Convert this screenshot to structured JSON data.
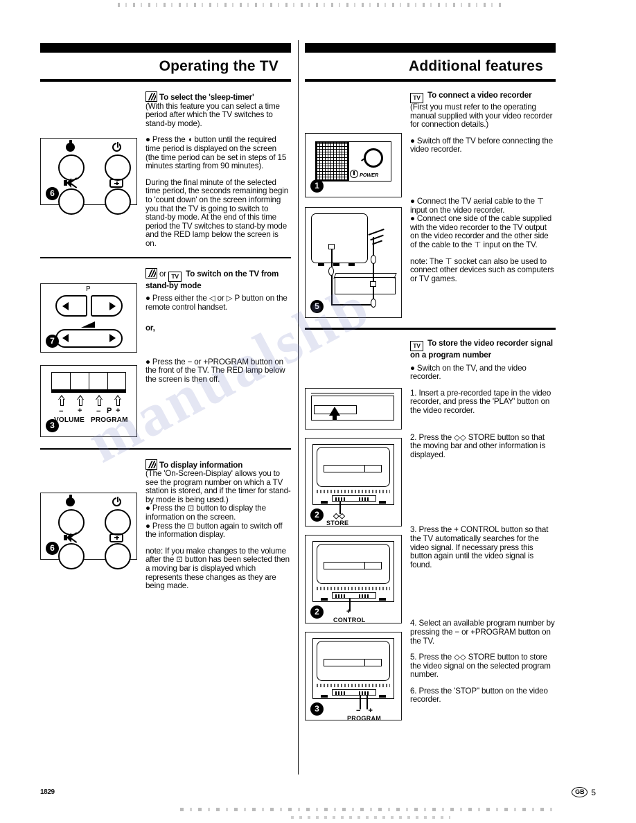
{
  "page": {
    "footer_code": "1829",
    "footer_region": "GB",
    "footer_page": "5",
    "watermark": "manualslib"
  },
  "left_column": {
    "header": "Operating the TV",
    "sections": [
      {
        "icon": "remote-icon",
        "heading": "To select the 'sleep-timer'",
        "paragraphs": [
          "(With this feature you can select a time period after which the TV switches to stand-by mode).",
          "● Press the ◖ button until the required time period is displayed on the screen (the time period can be set in steps of 15 minutes starting from 90 minutes).",
          "During the final minute of the selected time period, the seconds remaining begin to 'count down' on the screen informing you that the TV is going to switch to stand-by mode. At the end of this time period the TV switches to stand-by mode and the RED lamp below the screen is on."
        ],
        "figure": {
          "number": "6",
          "type": "remote-keypad"
        }
      },
      {
        "icon": "remote-icon",
        "icon2": "tv-icon",
        "connector": "or",
        "heading": "To switch on the TV from stand-by mode",
        "paragraphs": [
          "● Press either the ◁ or ▷ P button on the remote control handset.",
          "or,",
          "● Press the − or +PROGRAM button on the front of the TV. The RED lamp below the screen is then off."
        ],
        "figure": {
          "number": "7",
          "type": "rocker-keys",
          "label_p": "P"
        },
        "figure2": {
          "number": "3",
          "type": "front-panel",
          "symbols": [
            "−",
            "+",
            "−",
            "P",
            "+"
          ],
          "caption_left": "VOLUME",
          "caption_right": "PROGRAM"
        }
      },
      {
        "icon": "remote-icon",
        "heading": "To display information",
        "paragraphs": [
          "(The 'On-Screen-Display' allows you to see the program number on which a TV station is stored, and if the timer for stand-by mode is being used.)",
          "● Press the ⊡ button to display the information on the screen.",
          "● Press the ⊡ button again to switch off the information display.",
          "note: If you make changes to the volume after the ⊡ button has been selected then a moving bar is displayed which represents these changes as they are being made."
        ],
        "figure": {
          "number": "6",
          "type": "remote-keypad"
        }
      }
    ]
  },
  "right_column": {
    "header": "Additional features",
    "sections": [
      {
        "icon": "tv-icon",
        "heading": "To connect a video recorder",
        "paragraphs": [
          "(First you must refer to the operating manual supplied with your video recorder for connection details.)",
          "● Switch off the TV before connecting the video recorder.",
          "● Connect the TV aerial cable to the ⊤ input on the video recorder.",
          "● Connect one side of the cable supplied with the video recorder to the TV output on the video recorder and the other side of the cable to the ⊤ input on the TV.",
          "note: The ⊤ socket can also be used to connect other devices such as computers or TV games."
        ],
        "figure": {
          "number": "1",
          "type": "tv-front-power",
          "label": "POWER"
        },
        "figure2": {
          "number": "5",
          "type": "aerial-hookup"
        }
      },
      {
        "icon": "tv-icon",
        "heading": "To store the video recorder signal on a program number",
        "paragraphs": [
          "● Switch on the TV, and the video recorder.",
          "1. Insert a pre-recorded tape in the video recorder, and press the 'PLAY' button on the video recorder.",
          "2. Press the ◇◇ STORE button so that the moving bar and other information is displayed.",
          "3. Press the + CONTROL button so that the TV automatically searches for the video signal. If necessary press this button again until the video signal is found.",
          "4. Select an available program number by pressing the − or +PROGRAM button on the TV.",
          "5. Press the ◇◇ STORE button to store the video signal on the selected program number.",
          "6. Press the 'STOP\" button on the video recorder."
        ],
        "figures": [
          {
            "number": "",
            "type": "vcr-tape-insert"
          },
          {
            "number": "2",
            "type": "tv-callout",
            "callout_symbol": "◇◇",
            "callout_label": "STORE"
          },
          {
            "number": "2",
            "type": "tv-callout",
            "callout_symbol": "+",
            "callout_label": "CONTROL"
          },
          {
            "number": "3",
            "type": "tv-callout",
            "callout_symbol": "− +",
            "callout_label": "PROGRAM"
          }
        ]
      }
    ]
  }
}
